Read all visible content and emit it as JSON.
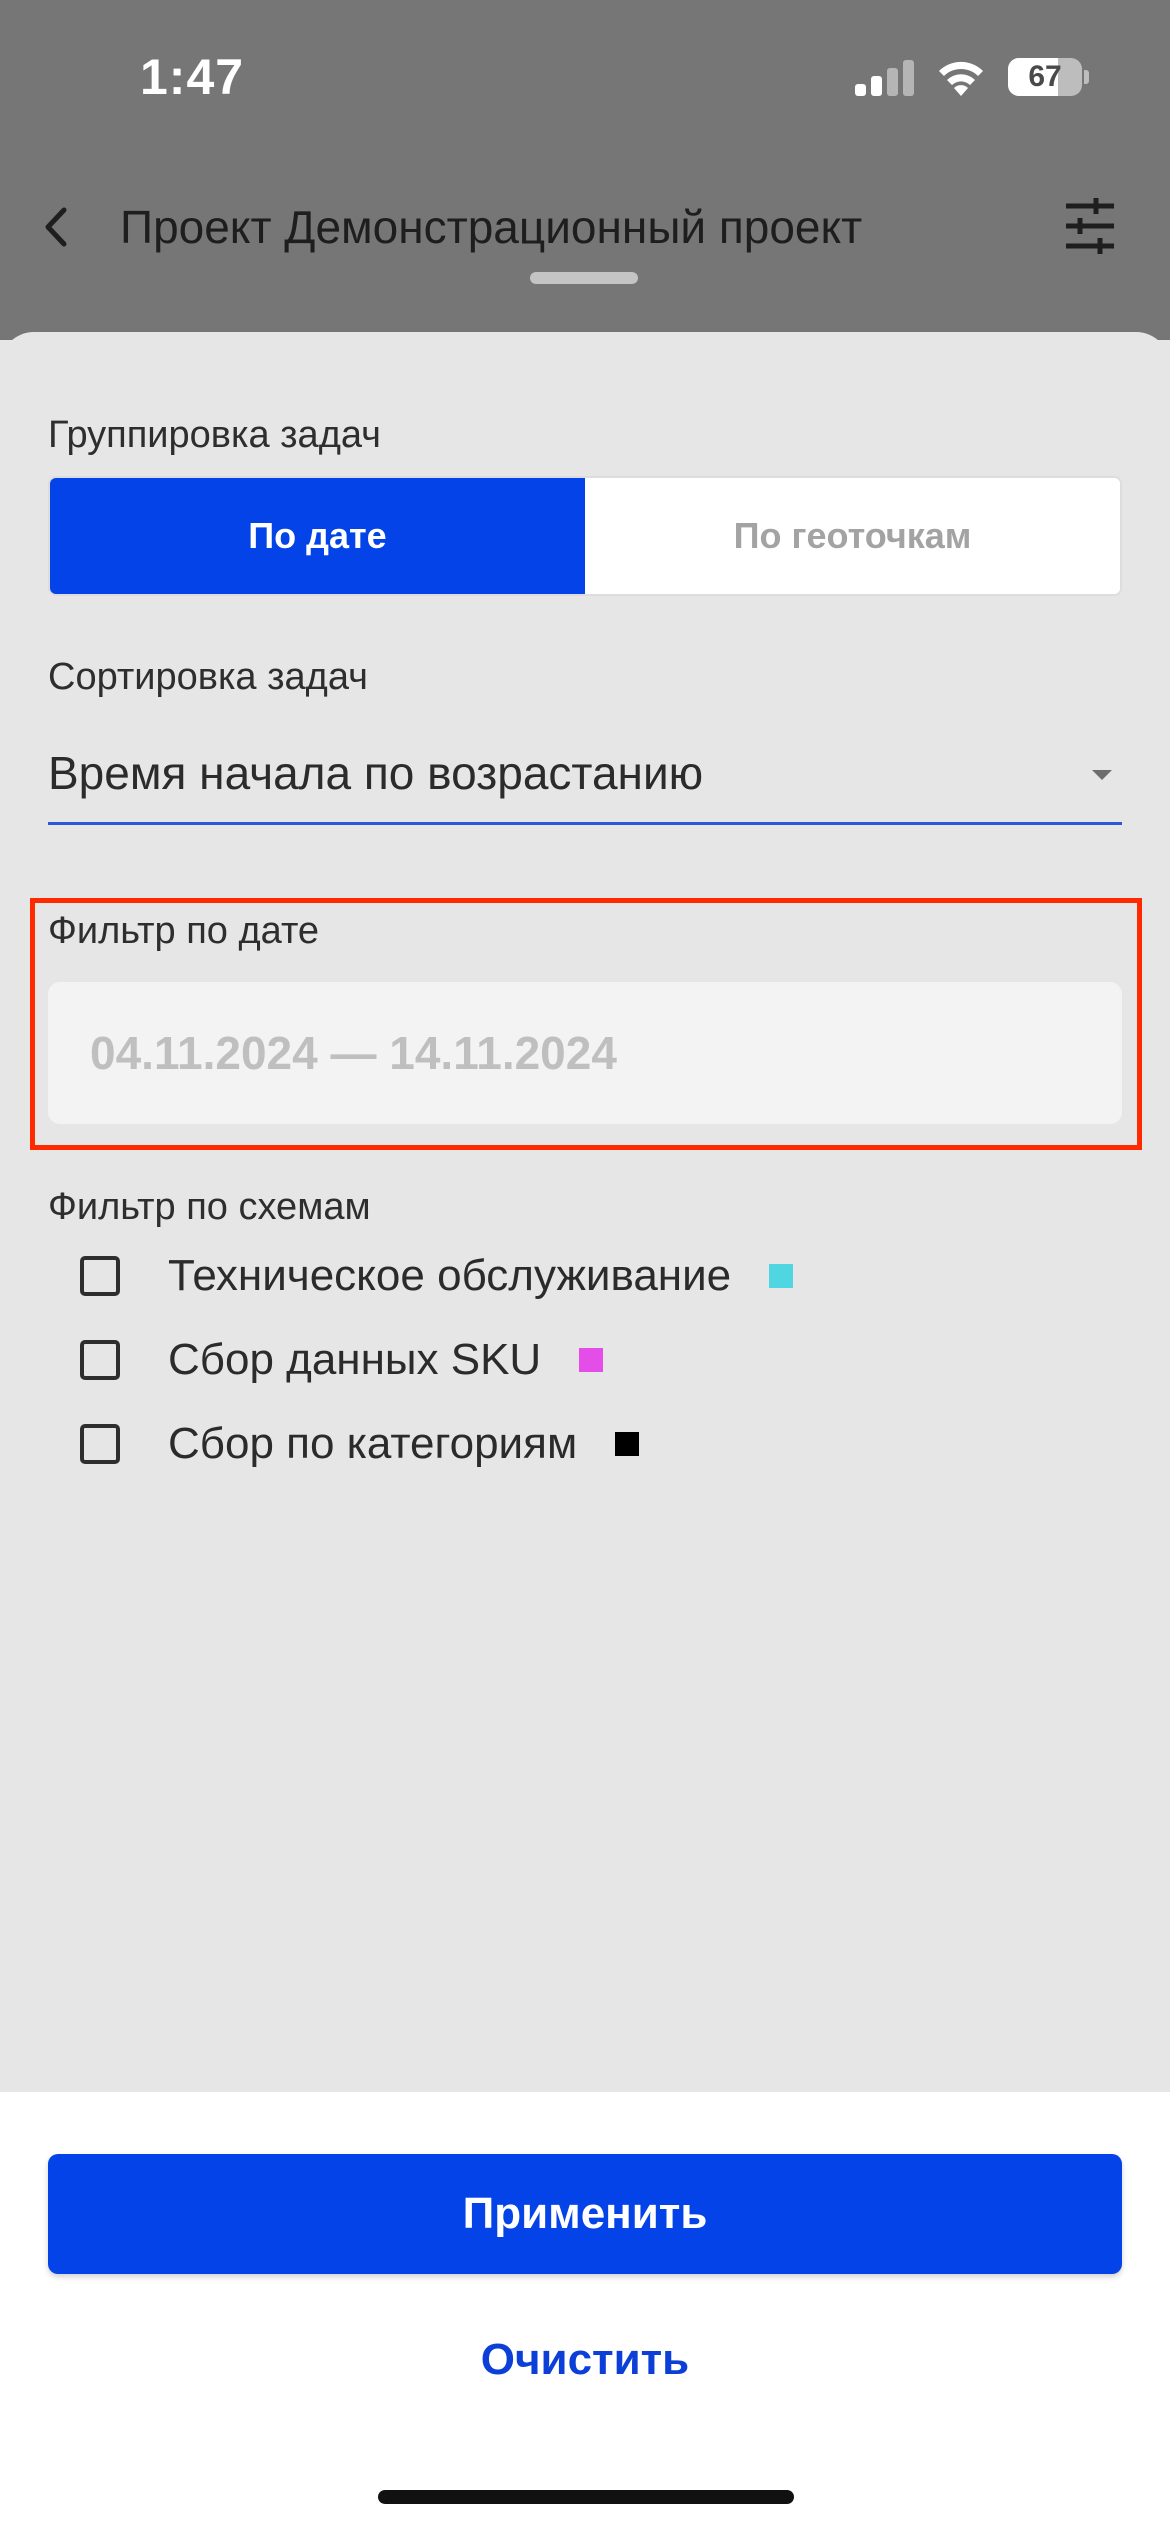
{
  "status_bar": {
    "time": "1:47",
    "battery_level": "67",
    "battery_fraction": 0.67,
    "signal_bars_active": 2,
    "signal_bars_total": 4
  },
  "nav": {
    "back_icon": "chevron-left-icon",
    "title": "Проект Демонстрационный проект",
    "filter_icon": "sliders-icon"
  },
  "grouping": {
    "label": "Группировка задач",
    "options": [
      {
        "label": "По дате",
        "selected": true
      },
      {
        "label": "По геоточкам",
        "selected": false
      }
    ]
  },
  "sorting": {
    "label": "Сортировка задач",
    "value": "Время начала по возрастанию",
    "caret_icon": "caret-down-icon"
  },
  "date_filter": {
    "label": "Фильтр по дате",
    "placeholder": "04.11.2024 — 14.11.2024"
  },
  "schemes": {
    "label": "Фильтр по схемам",
    "items": [
      {
        "label": "Техническое обслуживание",
        "color": "#4fd6e0",
        "checked": false
      },
      {
        "label": "Сбор данных SKU",
        "color": "#e44de8",
        "checked": false
      },
      {
        "label": "Сбор по категориям",
        "color": "#000000",
        "checked": false
      }
    ]
  },
  "actions": {
    "apply": "Применить",
    "clear": "Очистить"
  },
  "colors": {
    "accent": "#0343e8",
    "highlight": "#ff2a00",
    "overlay": "#767676"
  }
}
